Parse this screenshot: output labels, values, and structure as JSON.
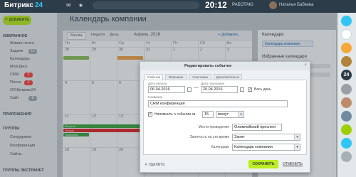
{
  "header": {
    "logo": "Битрикс",
    "logo_num": "24",
    "time": "20:12",
    "status": "РАБОТАЮ",
    "user": "Наталья Бабкина"
  },
  "sidebar": {
    "add_label": "ДОБАВИТЬ",
    "favorites": "ИЗБРАННОЕ",
    "items": [
      {
        "label": "Живая лента"
      },
      {
        "label": "Задачи",
        "count": "15"
      },
      {
        "label": "Календарь"
      },
      {
        "label": "Мой Диск"
      },
      {
        "label": "CRM",
        "count": "3"
      },
      {
        "label": "Почта",
        "count": "3"
      },
      {
        "label": "ОЛ Битрикс24"
      },
      {
        "label": "Сайт",
        "count": "8"
      }
    ],
    "apps": "ПРИЛОЖЕНИЯ",
    "groups": "ГРУППЫ",
    "groups_items": [
      {
        "label": "Сотрудники"
      },
      {
        "label": "Конференции"
      },
      {
        "label": "Сайты"
      }
    ],
    "extranet": "ГРУППЫ ЭКСТРАНЕТ"
  },
  "calendar": {
    "title": "Календарь компании",
    "views": [
      "Месяц",
      "Неделя",
      "День"
    ],
    "month": "Апрель, 2016",
    "add": "+ Добавить",
    "daynames": [
      "Пн",
      "Вт",
      "Ср",
      "Чт",
      "Пт",
      "Сб",
      "Вс"
    ],
    "rows": [
      [
        "28",
        "29",
        "30",
        "31",
        "1",
        "2",
        "3"
      ],
      [
        "4",
        "5",
        "6",
        "7",
        "8",
        "9",
        "10"
      ],
      [
        "11",
        "12",
        "13",
        "14",
        "15",
        "16",
        "17"
      ],
      [
        "18",
        "19",
        "20",
        "21",
        "22",
        "23",
        "24"
      ]
    ],
    "events": [
      {
        "label": "Встреча"
      },
      {
        "label": "Отпуск"
      },
      {
        "label": "Планерка"
      }
    ]
  },
  "right_panel": {
    "calendars": "Календари",
    "company": "Календарь компании",
    "favorites": "Избранные календари"
  },
  "right_bar": {
    "badge": "24",
    "colors": {
      "blue": "#2fc6f6",
      "dark": "#2c3c49",
      "green": "#9dcf00"
    }
  },
  "dialog": {
    "title": "Редактировать событие",
    "close": "×",
    "tabs": [
      "Событие",
      "Описание",
      "Участники",
      "Дополнительно"
    ],
    "start_label": "Дата начала",
    "start_date": "06.04.2016",
    "end_label": "Дата окончания",
    "end_date": "20.04.2016",
    "allday": "Весь день",
    "name_label": "Название",
    "name_value": "CRM конференция",
    "remind_label": "Напомнить о событии за",
    "remind_value": "15",
    "remind_unit": "минут",
    "location_label": "Место проведения",
    "location_value": "Олимпийский проспект",
    "accessibility_label": "Занятость на это время",
    "accessibility_value": "Занят",
    "calendar_label": "Календарь",
    "calendar_value": "Календарь компании",
    "delete_label": "УДАЛИТЬ",
    "save_label": "СОХРАНИТЬ",
    "cancel_label": "ОТМЕНИТЬ"
  }
}
